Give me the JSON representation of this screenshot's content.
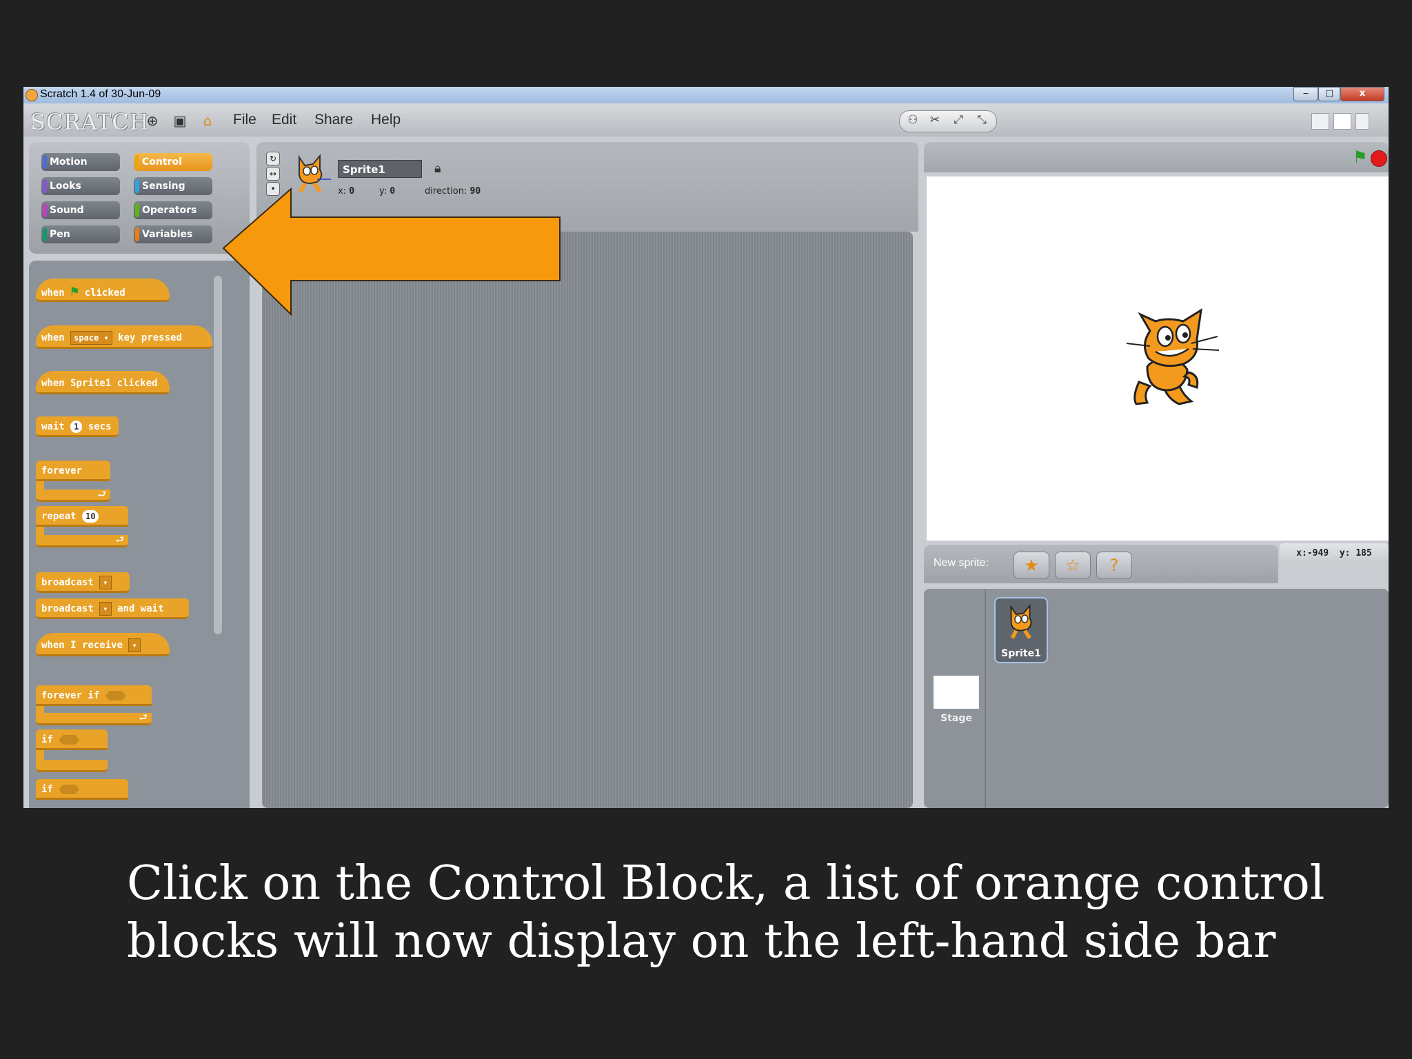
{
  "window": {
    "title": "Scratch 1.4 of 30-Jun-09",
    "logo": "SCRATCH",
    "minimize": "‒",
    "maximize": "□",
    "close": "x"
  },
  "menu": {
    "file": "File",
    "edit": "Edit",
    "share": "Share",
    "help": "Help"
  },
  "categories": {
    "motion": "Motion",
    "control": "Control",
    "looks": "Looks",
    "sensing": "Sensing",
    "sound": "Sound",
    "operators": "Operators",
    "pen": "Pen",
    "variables": "Variables",
    "selected": "Control",
    "colors": {
      "motion": "#4a6cd4",
      "control": "#e1a91a",
      "looks": "#8a55d7",
      "sensing": "#2ca5e2",
      "sound": "#bb42c3",
      "operators": "#5cb712",
      "pen": "#0e9a6c",
      "variables": "#ee7d16"
    }
  },
  "blocks": {
    "when_flag": {
      "a": "when",
      "b": "clicked"
    },
    "when_key": {
      "a": "when",
      "key": "space",
      "b": "key pressed"
    },
    "when_sprite_clicked": "when Sprite1 clicked",
    "wait": {
      "a": "wait",
      "value": "1",
      "b": "secs"
    },
    "forever": "forever",
    "repeat": {
      "a": "repeat",
      "value": "10"
    },
    "broadcast": "broadcast",
    "broadcast_wait": {
      "a": "broadcast",
      "b": "and wait"
    },
    "when_receive": "when I receive",
    "forever_if": "forever if",
    "if1": "if",
    "if2": "if"
  },
  "sprite": {
    "name": "Sprite1",
    "x_label": "x:",
    "x": "0",
    "y_label": "y:",
    "y": "0",
    "direction_label": "direction:",
    "direction": "90"
  },
  "stage": {
    "mouse_x_label": "x:",
    "mouse_x": "-949",
    "mouse_y_label": "y:",
    "mouse_y": "185",
    "new_sprite_label": "New sprite:",
    "sprite_thumb_label": "Sprite1",
    "stage_label": "Stage"
  },
  "caption": "Click on the Control Block, a list of orange control blocks will now display on the left-hand side bar",
  "colors": {
    "background": "#212121",
    "arrow": "#f7990c",
    "block": "#e9a328"
  }
}
